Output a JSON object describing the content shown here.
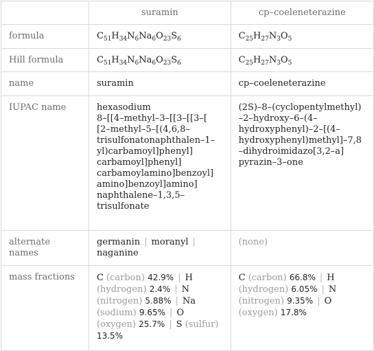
{
  "columns": [
    "",
    "suramin",
    "cp–coeleneterazine"
  ],
  "rows": {
    "formula": {
      "label": "formula",
      "suramin": [
        [
          "C",
          "51"
        ],
        [
          "H",
          "34"
        ],
        [
          "N",
          "6"
        ],
        [
          "Na",
          "6"
        ],
        [
          "O",
          "23"
        ],
        [
          "S",
          "6"
        ]
      ],
      "cp": [
        [
          "C",
          "25"
        ],
        [
          "H",
          "27"
        ],
        [
          "N",
          "3"
        ],
        [
          "O",
          "5"
        ]
      ]
    },
    "hill_formula": {
      "label": "Hill formula",
      "suramin": [
        [
          "C",
          "51"
        ],
        [
          "H",
          "34"
        ],
        [
          "N",
          "6"
        ],
        [
          "Na",
          "6"
        ],
        [
          "O",
          "23"
        ],
        [
          "S",
          "6"
        ]
      ],
      "cp": [
        [
          "C",
          "25"
        ],
        [
          "H",
          "27"
        ],
        [
          "N",
          "3"
        ],
        [
          "O",
          "5"
        ]
      ]
    },
    "name": {
      "label": "name",
      "suramin": "suramin",
      "cp": "cp–coeleneterazine"
    },
    "iupac_name": {
      "label": "IUPAC name",
      "suramin": "hexasodium 8–[[4–methyl–3–[[3–[[3–[[2–methyl–5–[(4,6,8–trisulfonatonaphthalen–1–yl)carbamoyl]phenyl]carbamoyl]phenyl]carbamoylamino]benzoyl]amino]benzoyl]amino]naphthalene–1,3,5–trisulfonate",
      "suramin_lines": [
        "hexasodium",
        "8–[[4–methyl–3–[[3–[[3–[",
        "[2–methyl–5–[(4,6,8–",
        "trisulfonatonaphthalen–1–",
        "yl)carbamoyl]phenyl]",
        "carbamoyl]phenyl]",
        "carbamoylamino]benzoyl]",
        "amino]benzoyl]amino]",
        "naphthalene–1,3,5–",
        "trisulfonate"
      ],
      "cp": "(2S)–8–(cyclopentylmethyl)–2–hydroxy–6–(4–hydroxyphenyl)–2–[(4–hydroxyphenyl)methyl]–7,8–dihydroimidazo[3,2–a]pyrazin–3–one",
      "cp_lines": [
        "(2S)–8–(cyclopentylmethyl)",
        "–2–hydroxy–6–(4–",
        "hydroxyphenyl)–2–[(4–",
        "hydroxyphenyl)methyl]–7,8",
        "–dihydroimidazo[3,2–a]",
        "pyrazin–3–one"
      ]
    },
    "alternate_names": {
      "label": "alternate names",
      "suramin": [
        "germanin",
        "moranyl",
        "naganine"
      ],
      "cp": "(none)"
    },
    "mass_fractions": {
      "label": "mass fractions",
      "suramin": [
        {
          "symbol": "C",
          "name": "carbon",
          "value": "42.9%"
        },
        {
          "symbol": "H",
          "name": "hydrogen",
          "value": "2.4%"
        },
        {
          "symbol": "N",
          "name": "nitrogen",
          "value": "5.88%"
        },
        {
          "symbol": "Na",
          "name": "sodium",
          "value": "9.65%"
        },
        {
          "symbol": "O",
          "name": "oxygen",
          "value": "25.7%"
        },
        {
          "symbol": "S",
          "name": "sulfur",
          "value": "13.5%"
        }
      ],
      "cp": [
        {
          "symbol": "C",
          "name": "carbon",
          "value": "66.8%"
        },
        {
          "symbol": "H",
          "name": "hydrogen",
          "value": "6.05%"
        },
        {
          "symbol": "N",
          "name": "nitrogen",
          "value": "9.35%"
        },
        {
          "symbol": "O",
          "name": "oxygen",
          "value": "17.8%"
        }
      ]
    }
  }
}
